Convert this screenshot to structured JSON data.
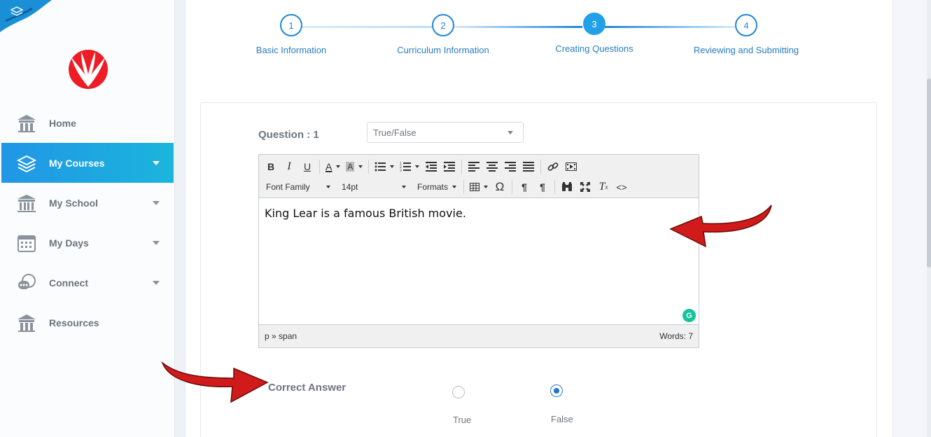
{
  "sidebar": {
    "items": [
      {
        "label": "Home",
        "icon": "home-icon",
        "active": false,
        "has_caret": false
      },
      {
        "label": "My Courses",
        "icon": "stack-icon",
        "active": true,
        "has_caret": true
      },
      {
        "label": "My School",
        "icon": "school-icon",
        "active": false,
        "has_caret": true
      },
      {
        "label": "My Days",
        "icon": "calendar-icon",
        "active": false,
        "has_caret": true
      },
      {
        "label": "Connect",
        "icon": "chat-icon",
        "active": false,
        "has_caret": true
      },
      {
        "label": "Resources",
        "icon": "library-icon",
        "active": false,
        "has_caret": false
      }
    ],
    "accent_color": "#1ea6e2"
  },
  "stepper": {
    "steps": [
      {
        "number": "1",
        "label": "Basic Information"
      },
      {
        "number": "2",
        "label": "Curriculum Information"
      },
      {
        "number": "3",
        "label": "Creating Questions"
      },
      {
        "number": "4",
        "label": "Reviewing and Submitting"
      }
    ],
    "current_step": 3
  },
  "question": {
    "label": "Question : 1",
    "type_value": "True/False"
  },
  "editor": {
    "toolbar": {
      "font_family": "Font Family",
      "font_size": "14pt",
      "formats": "Formats",
      "buttons_row1": [
        "bold-icon",
        "italic-icon",
        "underline-icon",
        "text-color-icon",
        "background-color-icon",
        "bullet-list-icon",
        "numbered-list-icon",
        "outdent-icon",
        "indent-icon",
        "align-left-icon",
        "align-center-icon",
        "align-right-icon",
        "justify-icon",
        "link-icon",
        "media-icon"
      ],
      "buttons_row2": [
        "table-icon",
        "special-char-icon",
        "ltr-icon",
        "rtl-icon",
        "find-replace-icon",
        "fullscreen-icon",
        "clear-format-icon",
        "source-code-icon"
      ]
    },
    "content": "King Lear is a famous British movie.",
    "path": "p » span",
    "word_count": "Words: 7"
  },
  "correct_answer": {
    "label": "Correct Answer",
    "options": [
      {
        "label": "True",
        "selected": false
      },
      {
        "label": "False",
        "selected": true
      }
    ]
  },
  "colors": {
    "step_blue": "#1f86d6",
    "annotation_arrow": "#d11a1a"
  }
}
